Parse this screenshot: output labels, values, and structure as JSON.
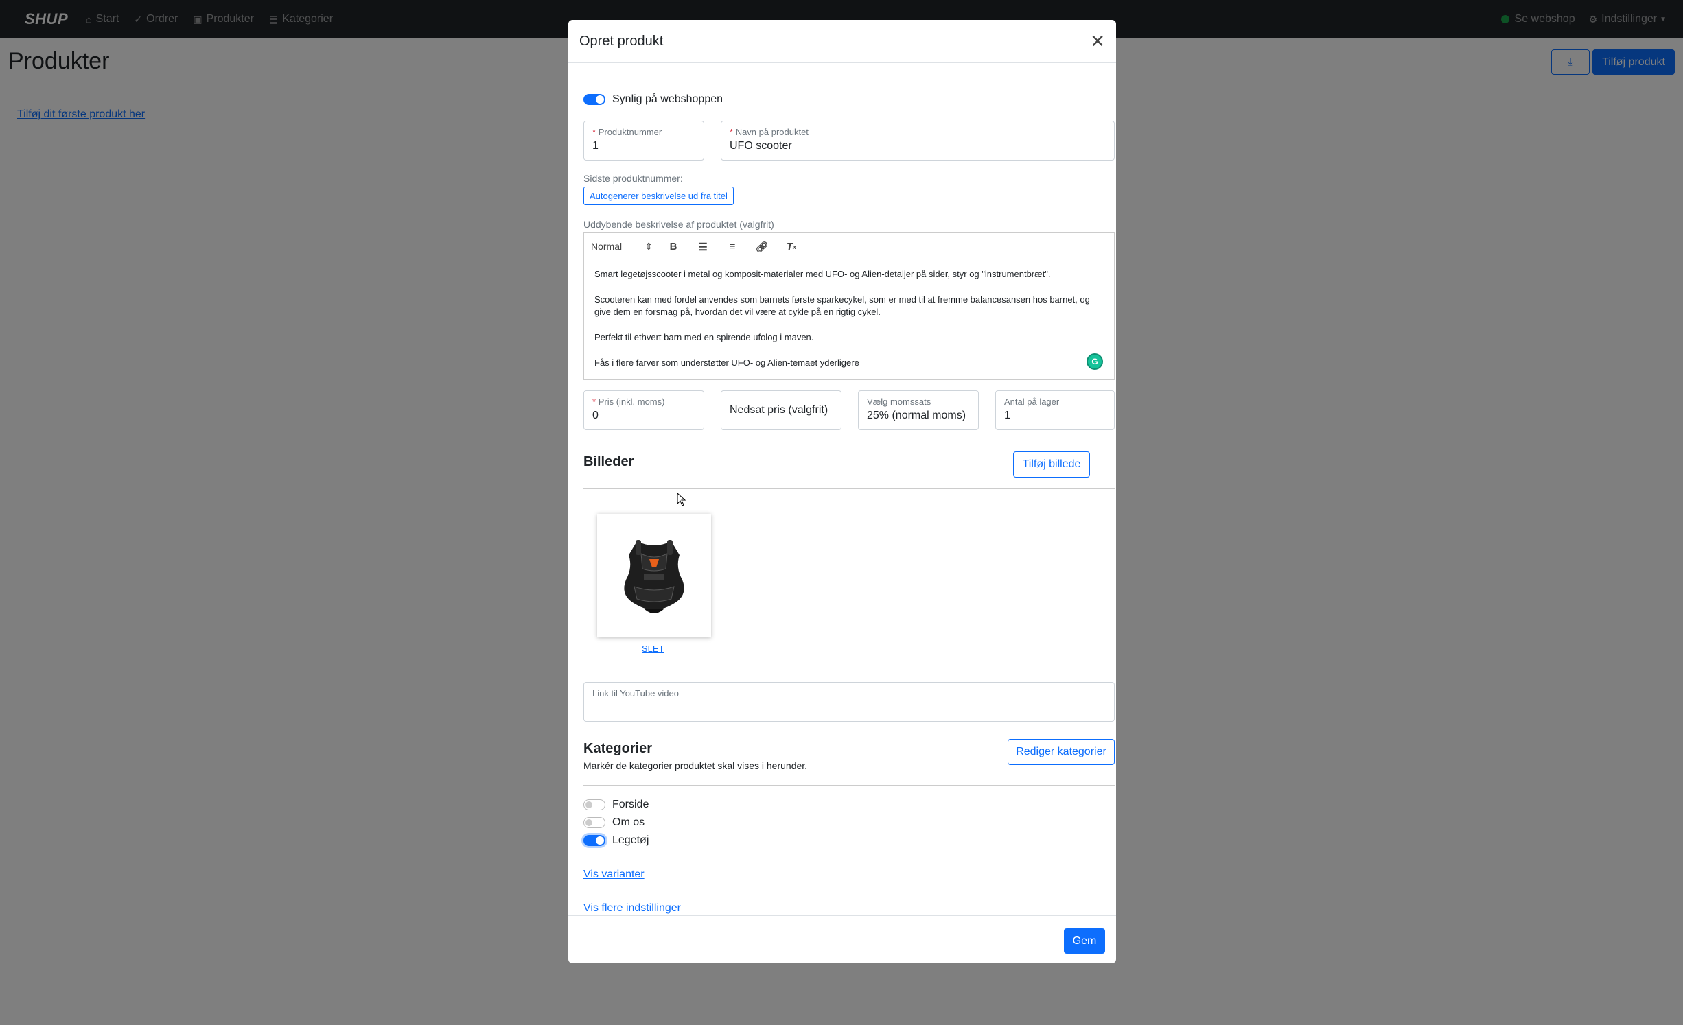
{
  "navbar": {
    "logo": "SHUP",
    "items": [
      {
        "label": "Start",
        "icon": "home-icon"
      },
      {
        "label": "Ordrer",
        "icon": "check-icon"
      },
      {
        "label": "Produkter",
        "icon": "box-icon"
      },
      {
        "label": "Kategorier",
        "icon": "archive-icon"
      }
    ],
    "webshop_label": "Se webshop",
    "settings_label": "Indstillinger"
  },
  "page": {
    "title": "Produkter",
    "first_product_link": "Tilføj dit første produkt her",
    "add_product_button": "Tilføj produkt"
  },
  "modal": {
    "title": "Opret produkt",
    "visible_label": "Synlig på webshoppen",
    "visible_on": true,
    "product_number": {
      "label": "Produktnummer",
      "value": "1"
    },
    "product_name": {
      "label": "Navn på produktet",
      "value": "UFO scooter"
    },
    "last_product_number_label": "Sidste produktnummer:",
    "autogenerate_button": "Autogenerer beskrivelse ud fra titel",
    "description_label": "Uddybende beskrivelse af produktet (valgfrit)",
    "editor": {
      "format": "Normal",
      "paragraphs": [
        "Smart legetøjsscooter i metal og komposit-materialer med UFO- og Alien-detaljer på sider, styr og \"instrumentbræt\".",
        "Scooteren kan med fordel anvendes som barnets første sparkecykel, som er med til at fremme balancesansen hos barnet, og give dem en forsmag på, hvordan det vil være at cykle på en rigtig cykel.",
        "Perfekt til ethvert barn med en spirende ufolog i maven.",
        "Fås i flere farver som understøtter UFO- og Alien-temaet yderligere"
      ]
    },
    "price": {
      "label": "Pris (inkl. moms)",
      "value": "0"
    },
    "discount_placeholder": "Nedsat pris (valgfrit)",
    "vat": {
      "label": "Vælg momssats",
      "value": "25% (normal moms)"
    },
    "stock": {
      "label": "Antal på lager",
      "value": "1"
    },
    "images_title": "Billeder",
    "add_image_button": "Tilføj billede",
    "delete_image_link": "SLET",
    "youtube_placeholder": "Link til YouTube video",
    "categories_title": "Kategorier",
    "categories_hint": "Markér de kategorier produktet skal vises i herunder.",
    "edit_categories_button": "Rediger kategorier",
    "categories": [
      {
        "label": "Forside",
        "checked": false
      },
      {
        "label": "Om os",
        "checked": false
      },
      {
        "label": "Legetøj",
        "checked": true
      }
    ],
    "show_variants_link": "Vis varianter",
    "more_settings_link": "Vis flere indstillinger",
    "save_button": "Gem"
  },
  "colors": {
    "primary": "#0d6efd",
    "navbar": "#212529",
    "status_green": "#1aa34a",
    "required": "#dc3545"
  }
}
